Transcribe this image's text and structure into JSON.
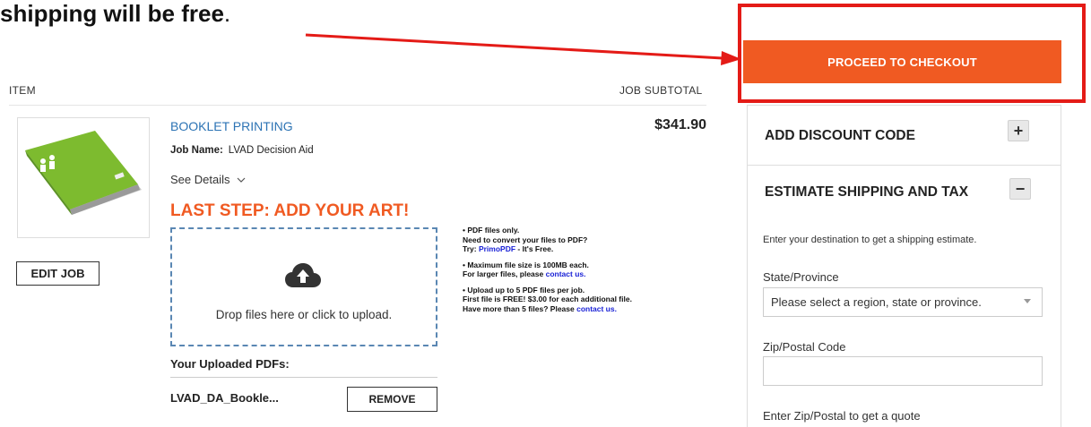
{
  "annotation": {
    "text": "shipping will be free",
    "punctuation": "."
  },
  "checkout": {
    "button_label": "PROCEED TO CHECKOUT"
  },
  "cart": {
    "headers": {
      "item": "ITEM",
      "subtotal": "JOB SUBTOTAL"
    },
    "product": {
      "title": "BOOKLET PRINTING",
      "price": "$341.90",
      "job_name_label": "Job Name:",
      "job_name_value": "LVAD Decision Aid",
      "see_details": "See Details",
      "edit_button": "EDIT JOB"
    },
    "upload": {
      "heading": "LAST STEP: ADD YOUR ART!",
      "drop_text": "Drop files here or click to upload.",
      "uploaded_title": "Your Uploaded PDFs:",
      "file_name": "LVAD_DA_Bookle...",
      "remove_button": "REMOVE"
    },
    "notes": {
      "n1_line1": "• PDF files only.",
      "n1_line2": "Need to convert your files to PDF?",
      "n1_try": "Try: ",
      "n1_link": "PrimoPDF",
      "n1_tail": " - It's Free.",
      "n2_line1": "• Maximum file size is 100MB each.",
      "n2_line2": "For larger files, please ",
      "n2_link": "contact us.",
      "n3_line1": "• Upload up to 5 PDF files per job.",
      "n3_line2": "First file is FREE! $3.00 for each additional file.",
      "n3_line3": "Have more than 5 files? Please ",
      "n3_link": "contact us."
    }
  },
  "sidebar": {
    "discount": {
      "title": "ADD DISCOUNT CODE",
      "toggle": "+"
    },
    "shipping": {
      "title": "ESTIMATE SHIPPING AND TAX",
      "toggle": "−",
      "intro": "Enter your destination to get a shipping estimate.",
      "state_label": "State/Province",
      "state_selected": "Please select a region, state or province.",
      "zip_label": "Zip/Postal Code",
      "zip_value": "",
      "quote_hint": "Enter Zip/Postal to get a quote"
    }
  },
  "colors": {
    "accent_orange": "#f05a22",
    "annotation_red": "#e41b17",
    "link_blue": "#2c73b4"
  }
}
